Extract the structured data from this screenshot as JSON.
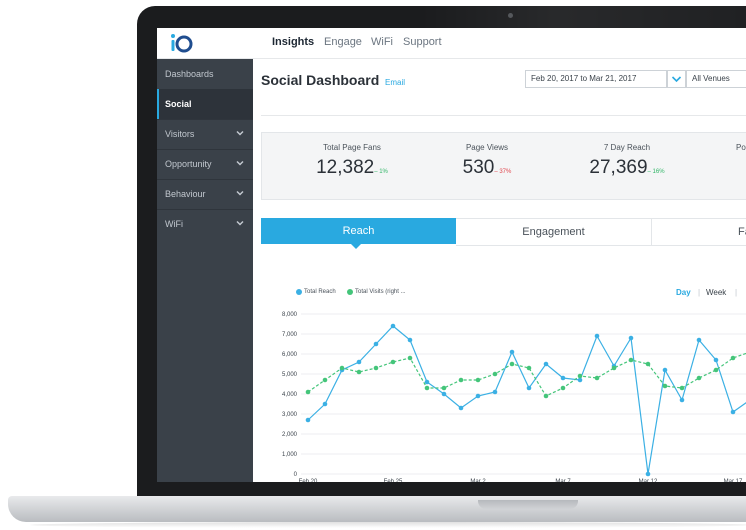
{
  "app": {
    "logo": "iO",
    "nav": [
      "Insights",
      "Engage",
      "WiFi",
      "Support"
    ],
    "active_nav": "Insights"
  },
  "sidebar": {
    "items": [
      {
        "label": "Dashboards",
        "has_chevron": false
      },
      {
        "label": "Social",
        "has_chevron": false,
        "active": true
      },
      {
        "label": "Visitors",
        "has_chevron": true
      },
      {
        "label": "Opportunity",
        "has_chevron": true
      },
      {
        "label": "Behaviour",
        "has_chevron": true
      },
      {
        "label": "WiFi",
        "has_chevron": true
      }
    ]
  },
  "page": {
    "title": "Social Dashboard",
    "email_link": "Email",
    "date_range": "Feb 20, 2017 to Mar 21, 2017",
    "venue": "All Venues"
  },
  "stats": [
    {
      "label": "Total Page Fans",
      "value": "12,382",
      "change": "– 1%",
      "direction": "up"
    },
    {
      "label": "Page Views",
      "value": "530",
      "change": "– 37%",
      "direction": "down"
    },
    {
      "label": "7 Day Reach",
      "value": "27,369",
      "change": "– 16%",
      "direction": "up"
    },
    {
      "label": "Po",
      "value": "",
      "change": "",
      "direction": ""
    }
  ],
  "tabs": [
    {
      "label": "Reach",
      "active": true
    },
    {
      "label": "Engagement",
      "active": false
    },
    {
      "label": "Fa",
      "active": false
    }
  ],
  "periods": [
    "Day",
    "Week"
  ],
  "active_period": "Day",
  "colors": {
    "accent": "#29a9e0",
    "reach_line": "#3bb0e4",
    "visits_line": "#44c57a",
    "sidebar": "#3a4149"
  },
  "chart_data": {
    "type": "line",
    "x_tick_labels": [
      "Feb 20",
      "Feb 25",
      "Mar 2",
      "Mar 7",
      "Mar 12",
      "Mar 17"
    ],
    "ylim": [
      0,
      8000
    ],
    "y_tick_labels": [
      "0",
      "1,000",
      "2,000",
      "3,000",
      "4,000",
      "5,000",
      "6,000",
      "7,000",
      "8,000"
    ],
    "grid": true,
    "legend_position": "top-left",
    "series": [
      {
        "name": "Total Reach",
        "style": "solid",
        "values": [
          2700,
          3500,
          5200,
          5600,
          6500,
          7400,
          6700,
          4600,
          4000,
          3300,
          3900,
          4100,
          6100,
          4300,
          5500,
          4800,
          4700,
          6900,
          5400,
          6800,
          0,
          5200,
          3700,
          6700,
          5700,
          3100,
          3700
        ]
      },
      {
        "name": "Total Visits (right ...",
        "style": "dashed",
        "values": [
          4100,
          4700,
          5300,
          5100,
          5300,
          5600,
          5800,
          4300,
          4300,
          4700,
          4700,
          5000,
          5500,
          5300,
          3900,
          4300,
          4900,
          4800,
          5300,
          5700,
          5500,
          4400,
          4300,
          4800,
          5200,
          5800,
          6100
        ]
      }
    ]
  }
}
